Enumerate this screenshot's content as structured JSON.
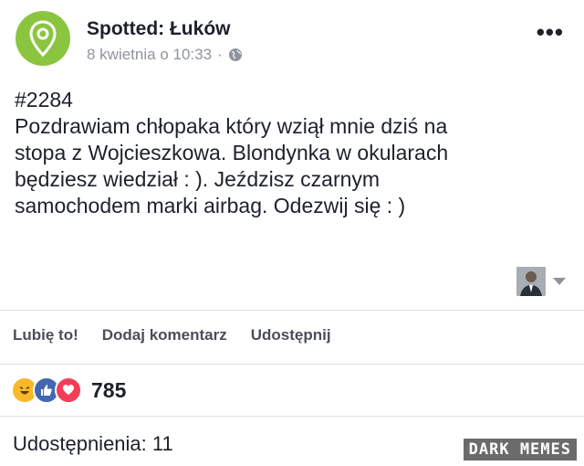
{
  "post": {
    "page_name": "Spotted: Łuków",
    "timestamp": "8 kwietnia o 10:33",
    "meta_separator": "·",
    "lines": [
      "#2284",
      "Pozdrawiam chłopaka który wziął mnie dziś na",
      "stopa z Wojcieszkowa. Blondynka w okularach",
      "będziesz wiedział : ). Jeździsz czarnym",
      "samochodem marki airbag. Odezwij się : )"
    ],
    "avatar_icon": "map-pin-icon",
    "privacy_icon": "globe-icon",
    "more_label": "•••"
  },
  "actions": {
    "like": "Lubię to!",
    "comment": "Dodaj komentarz",
    "share": "Udostępnij"
  },
  "reactions": {
    "icons": [
      "haha-icon",
      "like-icon",
      "love-icon"
    ],
    "count": "785"
  },
  "shares": {
    "label": "Udostępnienia: 11"
  },
  "watermark": "DARK MEMES",
  "colors": {
    "brand_green": "#8bc53f",
    "like_blue": "#4267b2",
    "love_red": "#f33e58",
    "haha_yellow": "#f7b928"
  }
}
